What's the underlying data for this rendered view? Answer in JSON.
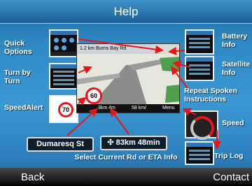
{
  "title": "Help",
  "softkeys": {
    "left": "Back",
    "right": "Contact"
  },
  "labels": {
    "quick_options": "Quick\nOptions",
    "turn_by_turn": "Turn by\nTurn",
    "speed_alert": "SpeedAlert",
    "battery_info": "Battery\nInfo",
    "satellite_info": "Satellite\nInfo",
    "repeat_spoken": "Repeat Spoken\nInstructions",
    "speed": "Speed",
    "trip_log": "Trip Log",
    "select_info": "Select Current Rd or ETA Info"
  },
  "map": {
    "street": "1.2 km Burns Bay Rd",
    "distance": "3km 4m",
    "speed": "58 km/",
    "menu": "Menu",
    "speed_limit_sign": "60"
  },
  "speed_alert_sign": "70",
  "pills": {
    "road": "Dumaresq St",
    "eta": "83km 48min"
  },
  "colors": {
    "annotation": "#e8161b",
    "header": "#2b78b0",
    "background": "#3b97d2"
  }
}
